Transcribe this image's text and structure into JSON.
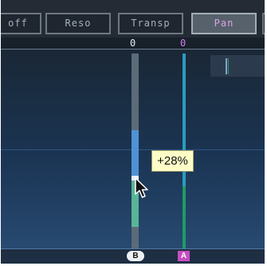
{
  "toolbar": {
    "buttons": [
      {
        "label": "off",
        "active": false
      },
      {
        "label": "Reso",
        "active": false
      },
      {
        "label": "Transp",
        "active": false
      },
      {
        "label": "Pan",
        "active": true
      },
      {
        "label": "",
        "active": false
      }
    ]
  },
  "ruler": {
    "marker_b_label": "0",
    "marker_a_label": "0",
    "marker_a_color": "#d07ee6"
  },
  "tooltip": {
    "text": "+28%"
  },
  "badges": {
    "b": "B",
    "a": "A"
  },
  "colors": {
    "track": "#5c6b78",
    "range_blue": "#4f92d4",
    "range_green": "#59b597",
    "line_cyan": "#2b9bc0",
    "line_green": "#1f9a68",
    "badge_a": "#c64ec0"
  },
  "icons": {
    "cursor": "arrow-cursor-icon"
  }
}
